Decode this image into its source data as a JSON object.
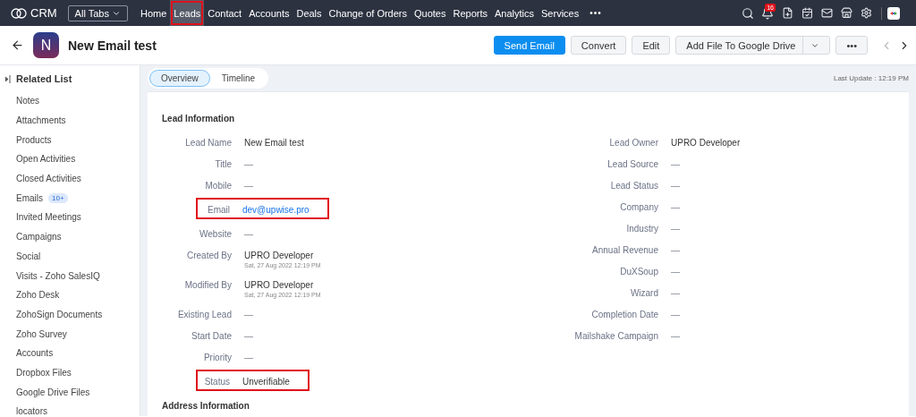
{
  "app": {
    "name": "CRM",
    "all_tabs": "All Tabs"
  },
  "nav": [
    {
      "label": "Home",
      "selected": false,
      "highlighted": false
    },
    {
      "label": "Leads",
      "selected": true,
      "highlighted": true
    },
    {
      "label": "Contact",
      "selected": false,
      "highlighted": false
    },
    {
      "label": "Accounts",
      "selected": false,
      "highlighted": false
    },
    {
      "label": "Deals",
      "selected": false,
      "highlighted": false
    },
    {
      "label": "Change of Orders",
      "selected": false,
      "highlighted": false
    },
    {
      "label": "Quotes",
      "selected": false,
      "highlighted": false
    },
    {
      "label": "Reports",
      "selected": false,
      "highlighted": false
    },
    {
      "label": "Analytics",
      "selected": false,
      "highlighted": false
    },
    {
      "label": "Services",
      "selected": false,
      "highlighted": false
    }
  ],
  "more": "•••",
  "notifications": "16",
  "record": {
    "initial": "N",
    "title": "New Email test"
  },
  "actions": [
    {
      "label": "Send Email",
      "kind": "primary"
    },
    {
      "label": "Convert",
      "kind": "plain"
    },
    {
      "label": "Edit",
      "kind": "plain"
    },
    {
      "label": "Add File To Google Drive",
      "kind": "split"
    },
    {
      "label": "•••",
      "kind": "plain"
    }
  ],
  "sidebar": {
    "title": "Related List",
    "items": [
      {
        "label": "Notes"
      },
      {
        "label": "Attachments"
      },
      {
        "label": "Products"
      },
      {
        "label": "Open Activities"
      },
      {
        "label": "Closed Activities"
      },
      {
        "label": "Emails",
        "badge": "10+"
      },
      {
        "label": "Invited Meetings"
      },
      {
        "label": "Campaigns"
      },
      {
        "label": "Social"
      },
      {
        "label": "Visits - Zoho SalesIQ"
      },
      {
        "label": "Zoho Desk"
      },
      {
        "label": "ZohoSign Documents"
      },
      {
        "label": "Zoho Survey"
      },
      {
        "label": "Accounts"
      },
      {
        "label": "Dropbox Files"
      },
      {
        "label": "Google Drive Files"
      },
      {
        "label": "locators"
      }
    ]
  },
  "tabs": [
    {
      "label": "Overview",
      "selected": true
    },
    {
      "label": "Timeline",
      "selected": false
    }
  ],
  "last_update": "Last Update : 12:19 PM",
  "section": "Lead Information",
  "left_fields": [
    {
      "label": "Lead Name",
      "value": "New Email test",
      "kind": "text",
      "highlighted": false
    },
    {
      "label": "Title",
      "value": "—",
      "kind": "empty",
      "highlighted": false
    },
    {
      "label": "Mobile",
      "value": "—",
      "kind": "empty",
      "highlighted": false
    },
    {
      "label": "Email",
      "value": "dev@upwise.pro",
      "kind": "link",
      "highlighted": true
    },
    {
      "label": "Website",
      "value": "—",
      "kind": "empty",
      "highlighted": false
    },
    {
      "label": "Created By",
      "value": "UPRO Developer",
      "sub": "Sat, 27 Aug 2022 12:19 PM",
      "kind": "text",
      "highlighted": false
    },
    {
      "label": "Modified By",
      "value": "UPRO Developer",
      "sub": "Sat, 27 Aug 2022 12:19 PM",
      "kind": "text",
      "highlighted": false
    },
    {
      "label": "Existing Lead",
      "value": "—",
      "kind": "empty",
      "highlighted": false
    },
    {
      "label": "Start Date",
      "value": "—",
      "kind": "empty",
      "highlighted": false
    },
    {
      "label": "Priority",
      "value": "—",
      "kind": "empty",
      "highlighted": false
    },
    {
      "label": "Status",
      "value": "Unverifiable",
      "kind": "text",
      "highlighted": true
    }
  ],
  "right_fields": [
    {
      "label": "Lead Owner",
      "value": "UPRO Developer",
      "kind": "text",
      "highlighted": false
    },
    {
      "label": "Lead Source",
      "value": "—",
      "kind": "empty",
      "highlighted": false
    },
    {
      "label": "Lead Status",
      "value": "—",
      "kind": "empty",
      "highlighted": false
    },
    {
      "label": "Company",
      "value": "—",
      "kind": "empty",
      "highlighted": false
    },
    {
      "label": "Industry",
      "value": "—",
      "kind": "empty",
      "highlighted": false
    },
    {
      "label": "Annual Revenue",
      "value": "—",
      "kind": "empty",
      "highlighted": false
    },
    {
      "label": "DuXSoup",
      "value": "—",
      "kind": "empty",
      "highlighted": false
    },
    {
      "label": "Wizard",
      "value": "—",
      "kind": "empty",
      "highlighted": false
    },
    {
      "label": "Completion Date",
      "value": "—",
      "kind": "empty",
      "highlighted": false
    },
    {
      "label": "Mailshake Campaign",
      "value": "—",
      "kind": "empty",
      "highlighted": false
    }
  ],
  "next_section": "Address Information"
}
